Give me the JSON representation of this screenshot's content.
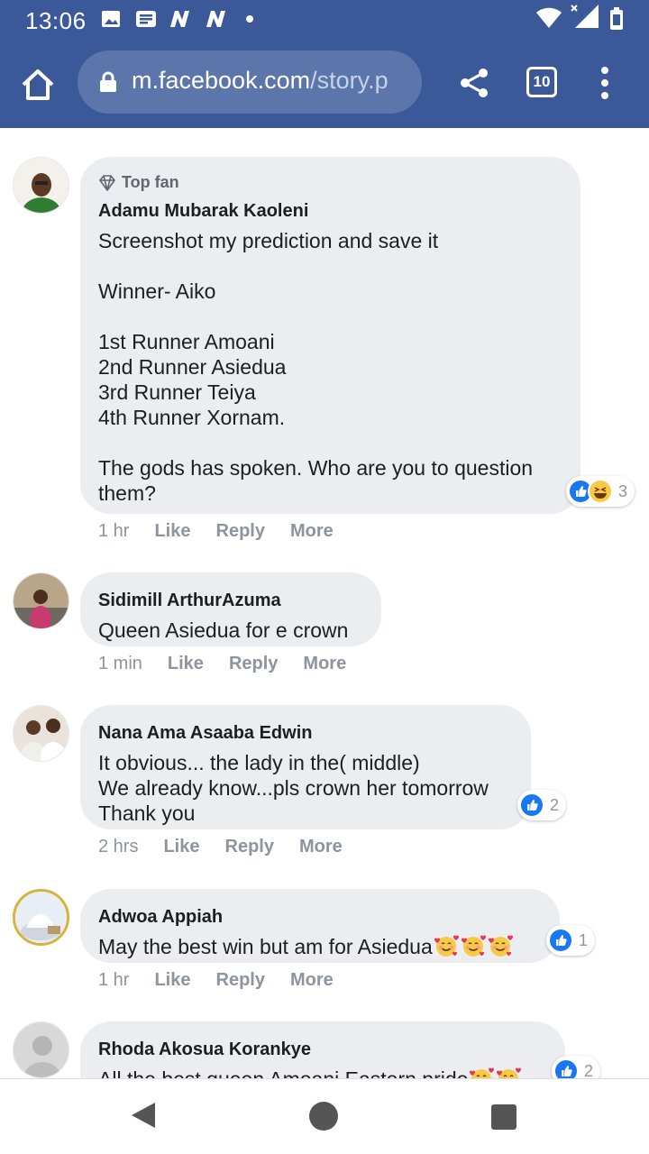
{
  "status_bar": {
    "time": "13:06",
    "icons": [
      "image-icon",
      "news-icon",
      "n-app-icon",
      "n-app-icon",
      "dot-icon",
      "wifi-icon",
      "signal-icon",
      "battery-icon"
    ]
  },
  "browser": {
    "url_host": "m.facebook.com",
    "url_path": "/story.p",
    "tab_count": "10"
  },
  "colors": {
    "header": "#3b5998",
    "bubble": "#ebedf0",
    "like_blue": "#1877f2",
    "muted": "#8d949e"
  },
  "comments": [
    {
      "badge": "Top fan",
      "author": "Adamu Mubarak Kaoleni",
      "text": "Screenshot my prediction and save it\n\nWinner- Aiko\n\n1st Runner Amoani\n2nd Runner Asiedua\n3rd Runner Teiya\n4th Runner Xornam.\n\nThe gods has spoken. Who are you to question them?",
      "reactions": [
        "like",
        "haha"
      ],
      "reaction_count": "3",
      "time": "1 hr",
      "like": "Like",
      "reply": "Reply",
      "more": "More"
    },
    {
      "author": "Sidimill ArthurAzuma",
      "text": "Queen Asiedua for e crown",
      "time": "1 min",
      "like": "Like",
      "reply": "Reply",
      "more": "More"
    },
    {
      "author": "Nana Ama Asaaba Edwin",
      "text": "It obvious... the lady in the( middle)\nWe already know...pls crown her tomorrow\nThank you",
      "reactions": [
        "like"
      ],
      "reaction_count": "2",
      "time": "2 hrs",
      "like": "Like",
      "reply": "Reply",
      "more": "More"
    },
    {
      "author": "Adwoa Appiah",
      "text": "May the best win but am for Asiedua",
      "emojis": [
        "smiling-face-with-hearts-icon",
        "smiling-face-with-hearts-icon",
        "smiling-face-with-hearts-icon"
      ],
      "reactions": [
        "like"
      ],
      "reaction_count": "1",
      "time": "1 hr",
      "like": "Like",
      "reply": "Reply",
      "more": "More"
    },
    {
      "author": "Rhoda Akosua Korankye",
      "text": "All the best queen Amoani Eastern pride",
      "emojis": [
        "smiling-face-with-hearts-icon",
        "smiling-face-with-hearts-icon"
      ],
      "reactions": [
        "like"
      ],
      "reaction_count": "2"
    }
  ]
}
